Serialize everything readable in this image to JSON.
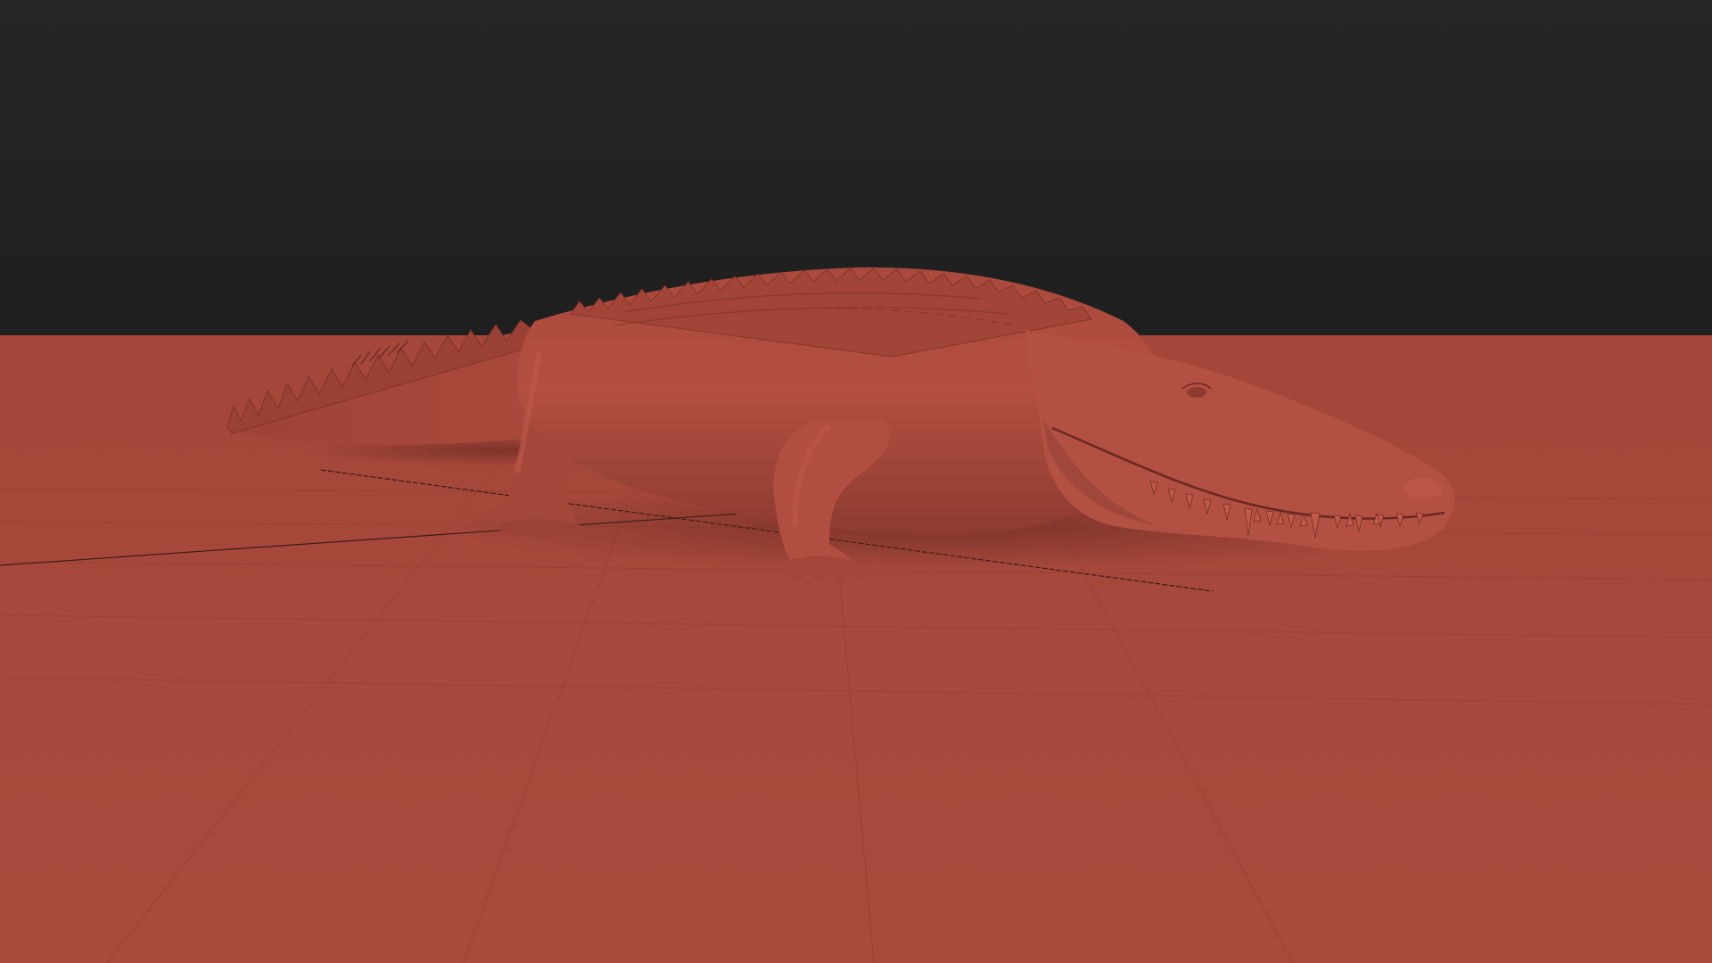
{
  "viewport": {
    "shading": "clay",
    "background_color": "#232323",
    "ground_color": "#a6483b",
    "model_color": "#b44e40",
    "grid_color": "#7a2f26"
  },
  "scene": {
    "subject": "crocodile",
    "icon": "crocodile-model-icon"
  }
}
